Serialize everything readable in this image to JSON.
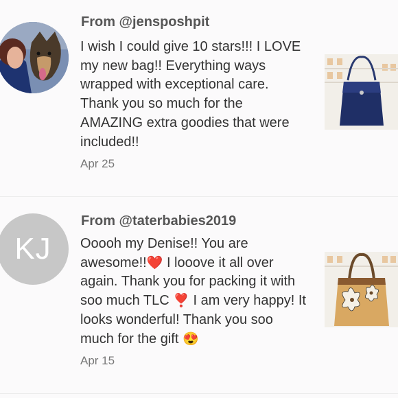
{
  "reviews": [
    {
      "from": "From @jensposhpit",
      "text": "I wish I could give 10 stars!!! I LOVE my new bag!! Everything ways wrapped with exceptional care. Thank you so much for the AMAZING extra goodies that were included!!",
      "date": "Apr 25",
      "avatar": "user-photo",
      "thumbnail": "navy-tote-bag"
    },
    {
      "from": "From @taterbabies2019",
      "text_parts": [
        "Ooooh my Denise!! You are awesome!!",
        "❤️",
        " I looove it all over again. Thank you for packing it with soo much TLC ",
        "❣️",
        " I am very happy! It looks wonderful! Thank you soo much for the gift ",
        "😍"
      ],
      "date": "Apr 15",
      "avatar_initials": "KJ",
      "thumbnail": "floral-tan-handbag"
    }
  ],
  "colors": {
    "background": "#fbfafb",
    "avatar_placeholder": "#c7c7c7",
    "divider": "#ececec"
  }
}
